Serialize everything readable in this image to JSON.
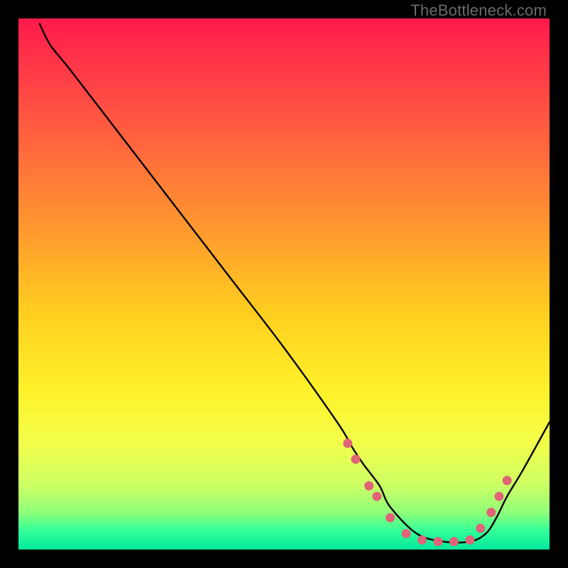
{
  "watermark": {
    "text": "TheBottleneck.com"
  },
  "chart_data": {
    "type": "line",
    "title": "",
    "xlabel": "",
    "ylabel": "",
    "xlim": [
      0,
      100
    ],
    "ylim": [
      0,
      100
    ],
    "grid": false,
    "series": [
      {
        "name": "curve",
        "color": "#000000",
        "x": [
          4,
          6,
          10,
          20,
          30,
          40,
          50,
          60,
          63,
          65,
          68,
          70,
          75,
          80,
          85,
          88,
          90,
          92,
          95,
          100
        ],
        "y": [
          99,
          95,
          90,
          77,
          64,
          51,
          38,
          24,
          19,
          16,
          12,
          8,
          3,
          1.5,
          1.5,
          3,
          6,
          10,
          15,
          24
        ]
      }
    ],
    "markers": {
      "name": "dots",
      "color": "#e06377",
      "x": [
        62,
        63.5,
        66,
        67.5,
        70,
        73,
        76,
        79,
        82,
        85,
        87,
        89,
        90.5,
        92
      ],
      "y": [
        20,
        17,
        12,
        10,
        6,
        3,
        1.8,
        1.5,
        1.5,
        1.8,
        4,
        7,
        10,
        13
      ]
    },
    "background_gradient": {
      "stops": [
        {
          "offset": 0.0,
          "color": "#ff1a4b"
        },
        {
          "offset": 0.1,
          "color": "#ff3b47"
        },
        {
          "offset": 0.25,
          "color": "#ff6a3d"
        },
        {
          "offset": 0.4,
          "color": "#ff9a2e"
        },
        {
          "offset": 0.55,
          "color": "#ffcd20"
        },
        {
          "offset": 0.7,
          "color": "#fff22a"
        },
        {
          "offset": 0.8,
          "color": "#f2ff4a"
        },
        {
          "offset": 0.88,
          "color": "#ccff66"
        },
        {
          "offset": 0.93,
          "color": "#8fff7a"
        },
        {
          "offset": 0.965,
          "color": "#33ff99"
        },
        {
          "offset": 1.0,
          "color": "#00e69b"
        }
      ]
    }
  }
}
